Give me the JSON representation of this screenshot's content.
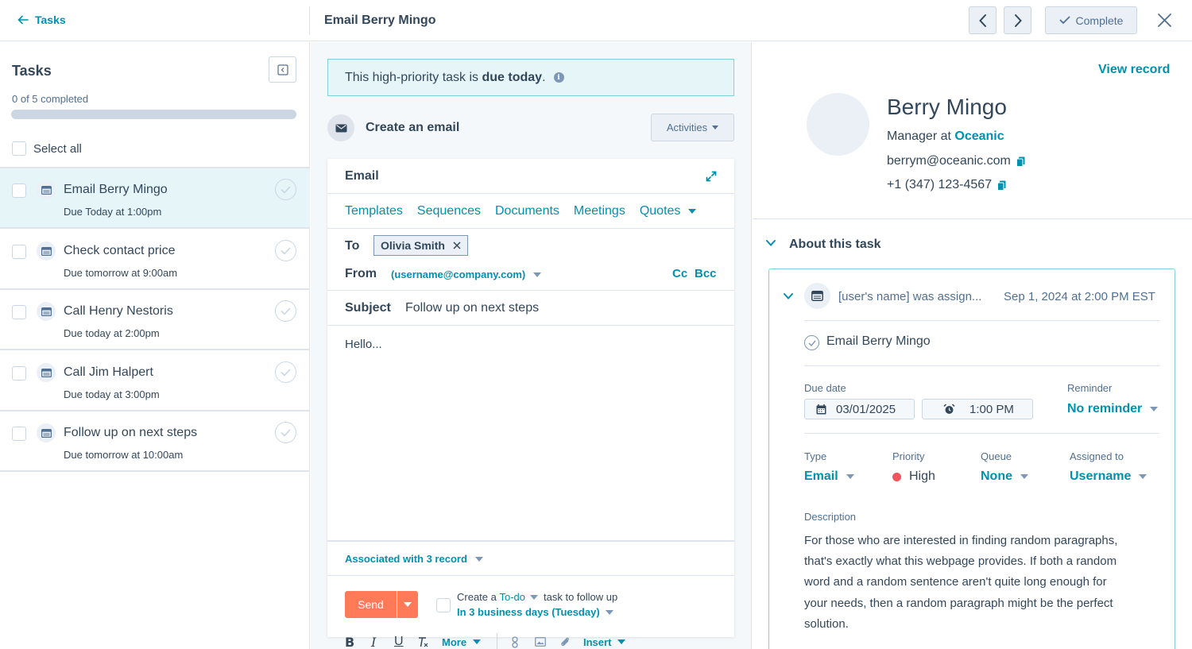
{
  "header": {
    "back_label": "Tasks",
    "title": "Email Berry Mingo",
    "complete_label": "Complete"
  },
  "left": {
    "title": "Tasks",
    "progress_text": "0 of 5 completed",
    "progress_fraction": 0,
    "select_all_label": "Select all",
    "tasks": [
      {
        "title": "Email Berry Mingo",
        "due": "Due Today at 1:00pm",
        "active": true
      },
      {
        "title": "Check contact price",
        "due": "Due tomorrow at 9:00am",
        "active": false
      },
      {
        "title": "Call Henry Nestoris",
        "due": "Due today at 2:00pm",
        "active": false
      },
      {
        "title": "Call Jim Halpert",
        "due": "Due today at 3:00pm",
        "active": false
      },
      {
        "title": "Follow up on next steps",
        "due": "Due tomorrow at 10:00am",
        "active": false
      }
    ]
  },
  "middle": {
    "alert_prefix": "This high-priority task is ",
    "alert_bold": "due today",
    "alert_suffix": ".",
    "create_title": "Create an email",
    "activities_label": "Activities",
    "email_title": "Email",
    "tabs": [
      "Templates",
      "Sequences",
      "Documents",
      "Meetings",
      "Quotes"
    ],
    "to_label": "To",
    "to_chip": "Olivia Smith",
    "from_label": "From",
    "from_value": "(username@company.com)",
    "cc_label": "Cc",
    "bcc_label": "Bcc",
    "subject_label": "Subject",
    "subject_value": "Follow up on next steps",
    "body": "Hello...",
    "toolbar": {
      "more_label": "More",
      "insert_label": "Insert"
    },
    "associated_label": "Associated with 3 record",
    "send_label": "Send",
    "followup_prefix": "Create a ",
    "followup_type": "To-do",
    "followup_suffix": "task to follow up",
    "followup_when": "In 3 business days (Tuesday)"
  },
  "right": {
    "view_record_label": "View record",
    "contact": {
      "name": "Berry Mingo",
      "role_prefix": "Manager at ",
      "company": "Oceanic",
      "email": "berrym@oceanic.com",
      "phone": "+1 (347) 123-4567"
    },
    "about_title": "About this task",
    "assign_text": "[user's name] was assign...",
    "assign_date": "Sep 1, 2024 at 2:00 PM EST",
    "task_name": "Email Berry Mingo",
    "due_date_label": "Due date",
    "due_date": "03/01/2025",
    "due_time": "1:00 PM",
    "reminder_label": "Reminder",
    "reminder_value": "No reminder",
    "type_label": "Type",
    "type_value": "Email",
    "priority_label": "Priority",
    "priority_value": "High",
    "queue_label": "Queue",
    "queue_value": "None",
    "assigned_label": "Assigned to",
    "assigned_value": "Username",
    "description_label": "Description",
    "description_lines": [
      "For those who are interested in finding random paragraphs,",
      "that's exactly what this webpage provides. If both a random",
      "word and a random sentence aren't quite long enough for",
      "your needs, then a random paragraph might be the perfect",
      "solution."
    ]
  },
  "colors": {
    "accent": "#0091ae",
    "send": "#ff7a59",
    "priority_high": "#f2545b",
    "text": "#33475b"
  }
}
